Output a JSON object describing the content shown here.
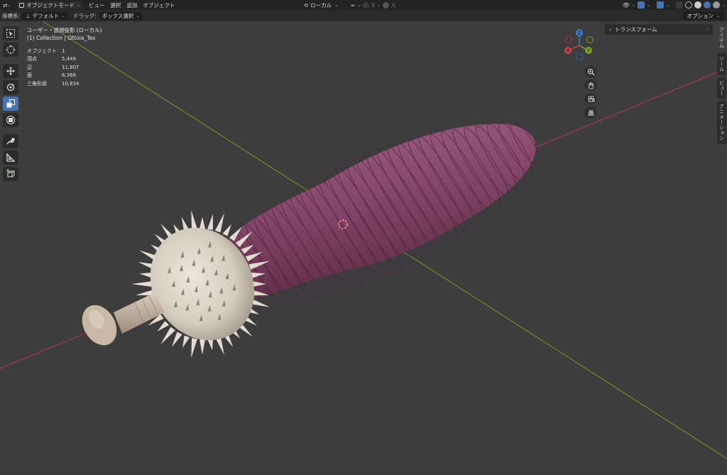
{
  "header": {
    "mode_label": "オブジェクトモード",
    "menu": [
      "ビュー",
      "選択",
      "追加",
      "オブジェクト"
    ],
    "orientation_label": "ローカル"
  },
  "tool_header": {
    "coord_label": "座標系:",
    "coord_value": "デフォルト",
    "drag_label": "ドラッグ:",
    "drag_value": "ボックス選択",
    "options_label": "オプション"
  },
  "viewport": {
    "view_title": "ユーザー・透視投影 (ローカル)",
    "collection_label": "(1) Collection | Ottoia_Tex",
    "stats": [
      {
        "key": "オブジェクト",
        "value": "1"
      },
      {
        "key": "頂点",
        "value": "5,449"
      },
      {
        "key": "辺",
        "value": "11,807"
      },
      {
        "key": "面",
        "value": "6,366"
      },
      {
        "key": "三角形面",
        "value": "10,834"
      }
    ]
  },
  "gizmo": {
    "x": "X",
    "y": "Y",
    "z": "Z"
  },
  "npanel": {
    "section_label": "トランスフォーム",
    "tabs": [
      "アイテム",
      "ツール",
      "ビュー",
      "アニメーション"
    ]
  },
  "colors": {
    "x_axis": "#c8404a",
    "y_axis": "#7aa12a",
    "z_axis": "#3a7bd5",
    "accent": "#4772b3",
    "body": "#8a4a6e",
    "proboscis": "#d6d0c4"
  },
  "icons": [
    "transform-icon",
    "cursor-icon",
    "move-icon",
    "rotate-icon",
    "scale-icon",
    "transform-all-icon",
    "annotate-icon",
    "measure-icon",
    "add-cube-icon",
    "zoom-icon",
    "hand-icon",
    "camera-icon",
    "grid-icon"
  ]
}
